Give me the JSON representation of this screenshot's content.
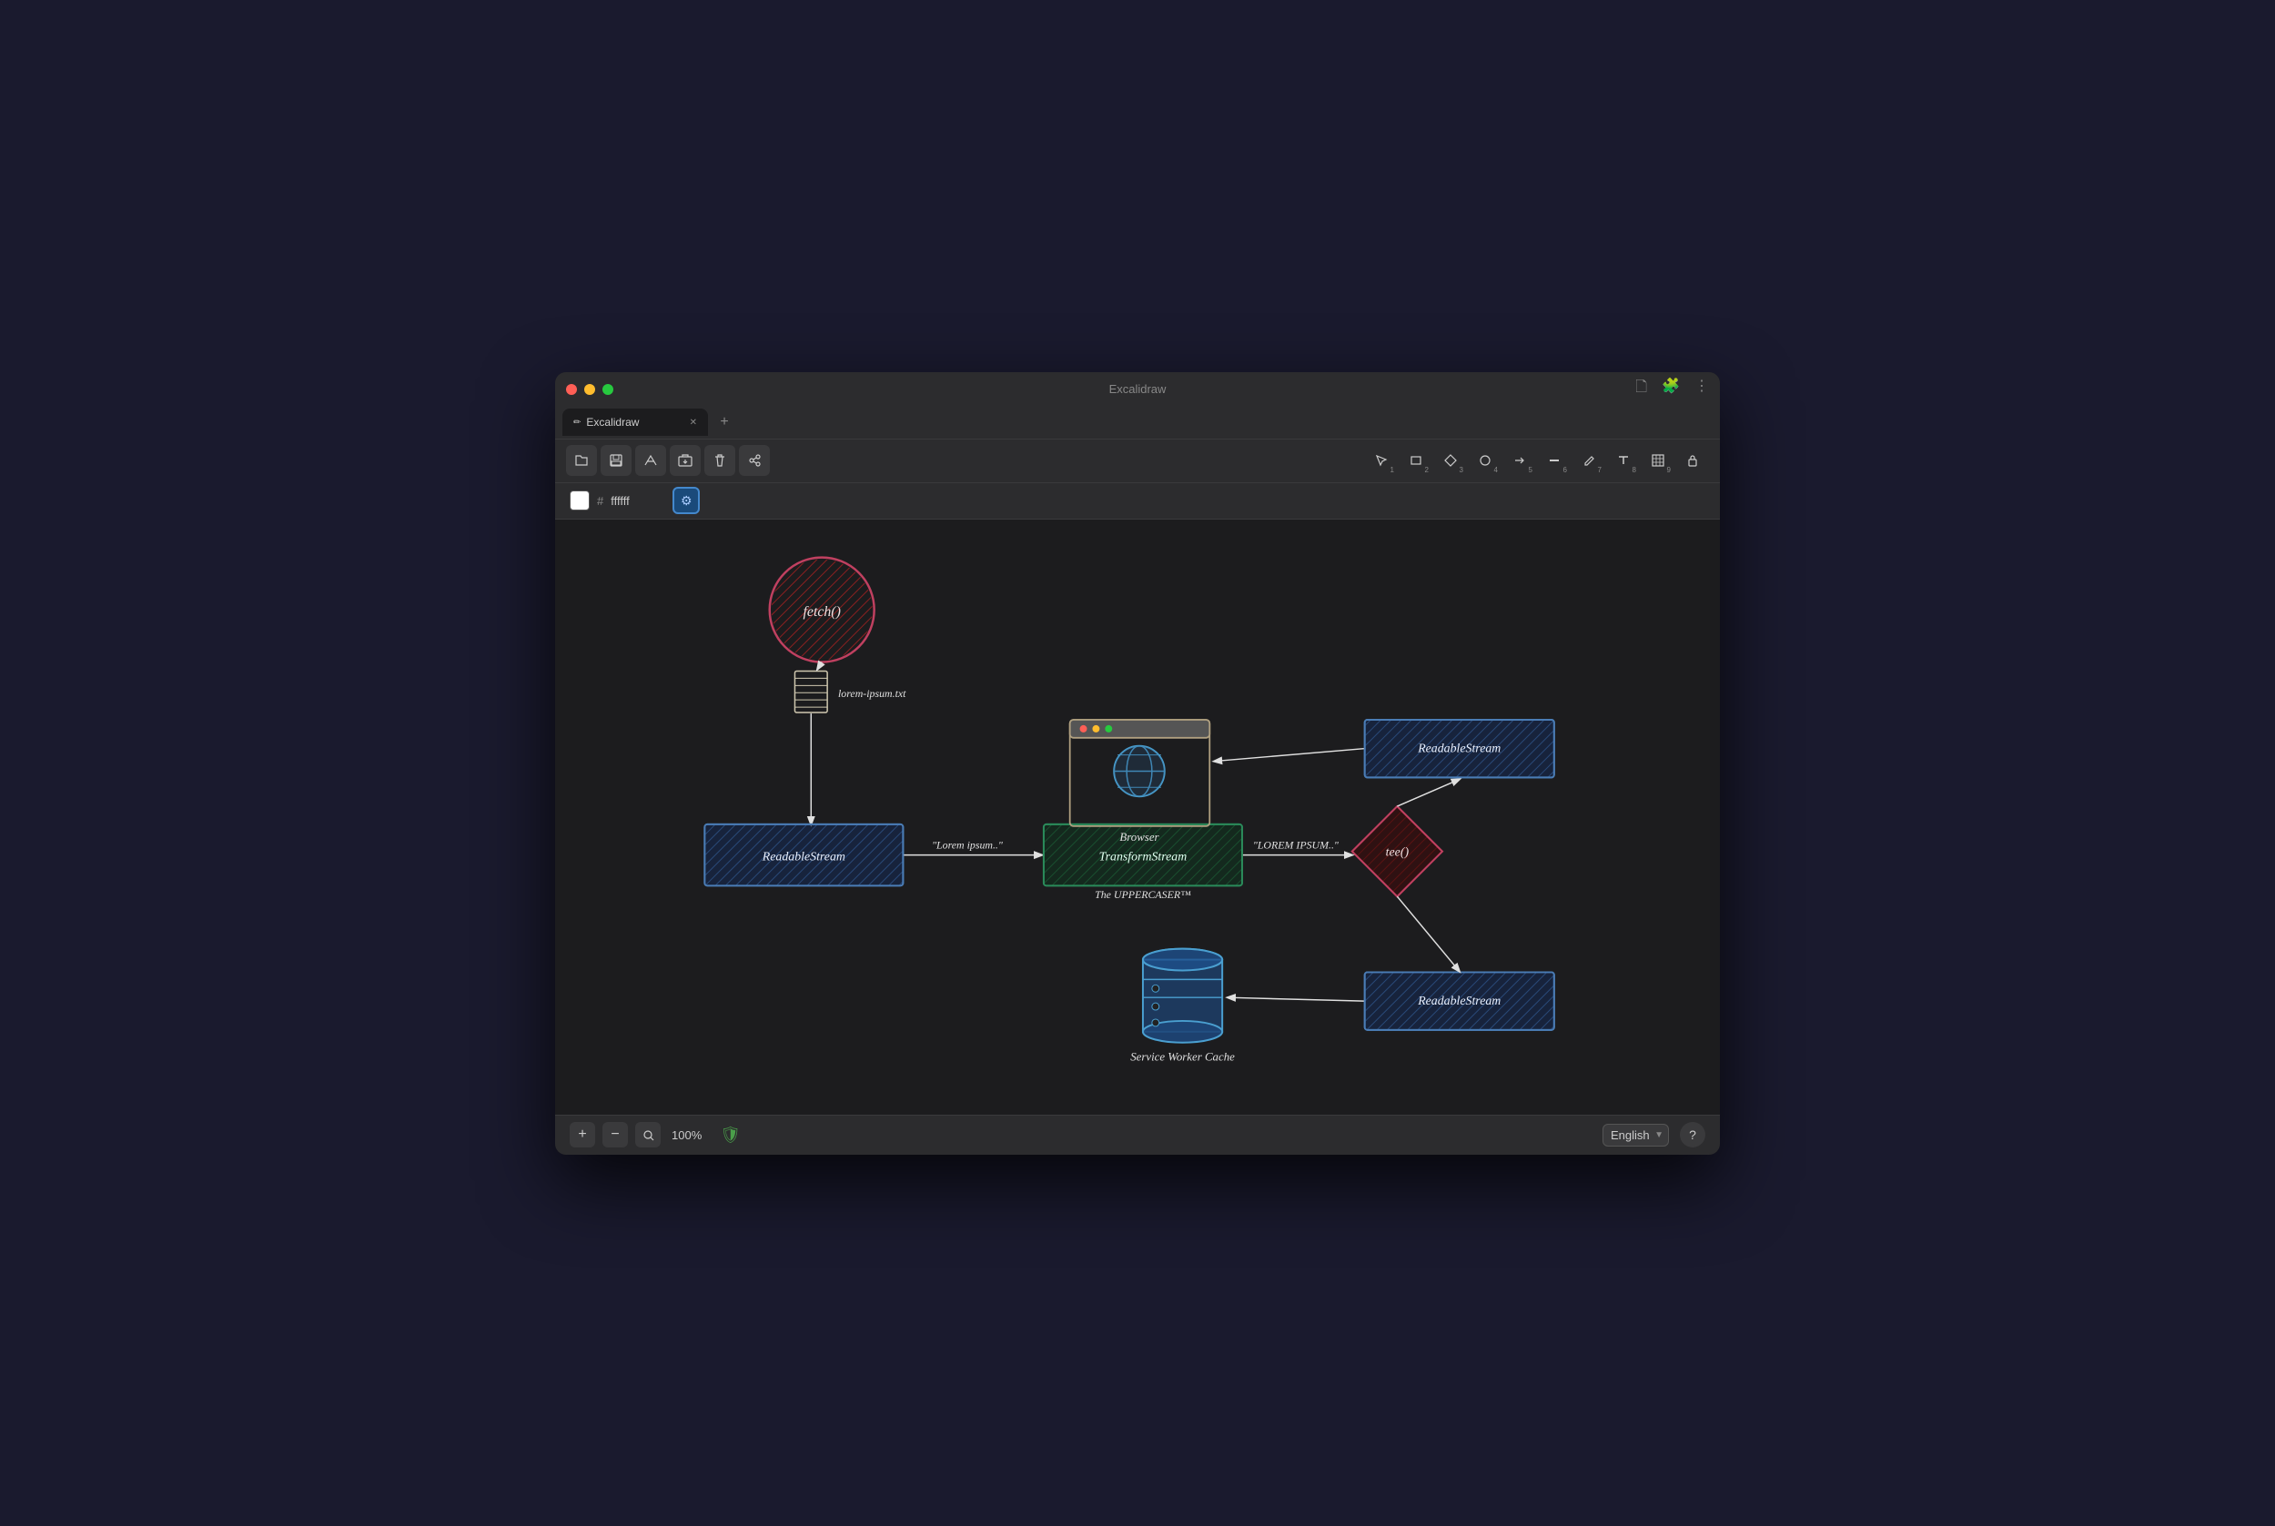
{
  "window": {
    "title": "Excalidraw",
    "tab_label": "Excalidraw"
  },
  "toolbar": {
    "file_icon": "📁",
    "save_icon": "💾",
    "collab_icon": "🖊",
    "export_icon": "📤",
    "trash_icon": "🗑",
    "users_icon": "👥"
  },
  "drawing_tools": [
    {
      "id": "select",
      "label": "⬡",
      "num": "1"
    },
    {
      "id": "rect",
      "label": "▭",
      "num": "2"
    },
    {
      "id": "diamond",
      "label": "◆",
      "num": "3"
    },
    {
      "id": "circle",
      "label": "●",
      "num": "4"
    },
    {
      "id": "arrow",
      "label": "→",
      "num": "5"
    },
    {
      "id": "line",
      "label": "—",
      "num": "6"
    },
    {
      "id": "pencil",
      "label": "✏",
      "num": "7"
    },
    {
      "id": "text",
      "label": "A",
      "num": "8"
    },
    {
      "id": "table",
      "label": "⊞",
      "num": "9"
    },
    {
      "id": "lock",
      "label": "🔒",
      "num": ""
    }
  ],
  "color_bar": {
    "hash": "#",
    "value": "ffffff",
    "settings_icon": "⚙"
  },
  "diagram": {
    "fetch_label": "fetch()",
    "doc_label": "lorem-ipsum.txt",
    "readable_stream_left": "ReadableStream",
    "transform_stream": "TransformStream",
    "transform_label": "The UPPERCASER™",
    "tee_label": "tee()",
    "browser_label": "Browser",
    "readable_stream_top_right": "ReadableStream",
    "readable_stream_bottom_right": "ReadableStream",
    "service_worker_label": "Service Worker Cache",
    "lorem_ipsum_arrow": "\"Lorem ipsum..\"",
    "lorem_ipsum_upper_arrow": "\"LOREM IPSUM..\""
  },
  "bottom_bar": {
    "zoom_plus": "+",
    "zoom_minus": "−",
    "zoom_search": "🔍",
    "zoom_value": "100%",
    "language": "English",
    "help": "?"
  }
}
